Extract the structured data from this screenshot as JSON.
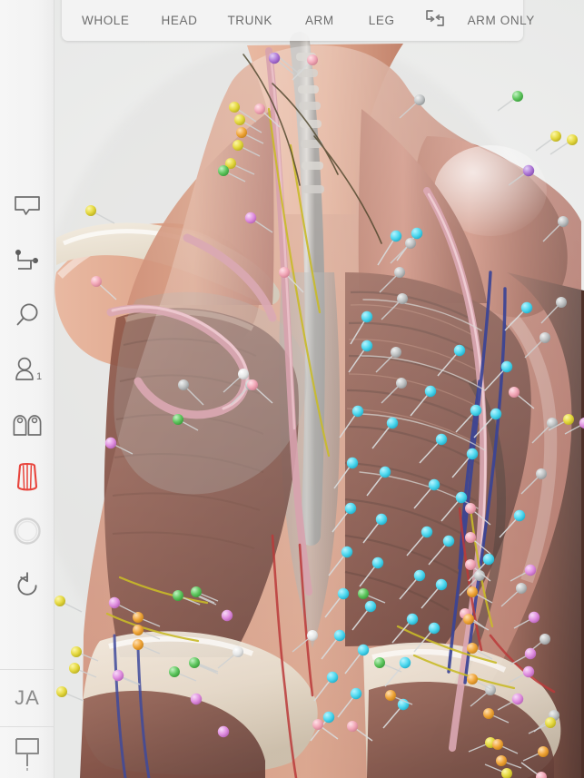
{
  "app": {
    "background_color": "#eceded",
    "sidebar_bg": "#f4f4f4",
    "toolbar_bg": "#f3f3f3",
    "text_color": "#6d6d6d",
    "accent_red": "#e8443c"
  },
  "toolbar": {
    "tabs": [
      {
        "label": "WHOLE",
        "name": "tab-whole",
        "active": false
      },
      {
        "label": "HEAD",
        "name": "tab-head",
        "active": false
      },
      {
        "label": "TRUNK",
        "name": "tab-trunk",
        "active": false
      },
      {
        "label": "ARM",
        "name": "tab-arm",
        "active": false
      },
      {
        "label": "LEG",
        "name": "tab-leg",
        "active": false
      }
    ],
    "swap_icon": "swap-exchange-icon",
    "arm_only_label": "ARM ONLY"
  },
  "sidebar": {
    "items": [
      {
        "name": "sidebar-item-label-bubble",
        "icon": "speech-bubble-icon",
        "label": ""
      },
      {
        "name": "sidebar-item-connector",
        "icon": "node-connector-icon",
        "label": ""
      },
      {
        "name": "sidebar-item-search",
        "icon": "magnifier-icon",
        "label": ""
      },
      {
        "name": "sidebar-item-gender",
        "icon": "person-icon",
        "label": "1"
      },
      {
        "name": "sidebar-item-compare",
        "icon": "split-person-icon",
        "label": ""
      },
      {
        "name": "sidebar-item-muscle",
        "icon": "muscle-fiber-icon",
        "label": "",
        "active": true
      },
      {
        "name": "sidebar-item-opacity",
        "icon": "circle-icon",
        "label": ""
      },
      {
        "name": "sidebar-item-reset",
        "icon": "undo-reset-icon",
        "label": ""
      }
    ],
    "language_label": "JA",
    "bottom_icon": "speech-bubble-icon"
  },
  "viewport": {
    "model_name": "human-anatomy-back-view",
    "description": "3D human male muscular system, posterior view, torso and arms with annotation pins"
  },
  "pins": {
    "colors": {
      "cyan": "#4fd8ef",
      "pink": "#f2a8b8",
      "gray": "#b9bcbd",
      "yellow": "#e4d83e",
      "green": "#5fc65f",
      "orange": "#f0a63a",
      "magenta": "#e08fe0",
      "purple": "#b07ad8",
      "white": "#e8e8e8"
    }
  }
}
